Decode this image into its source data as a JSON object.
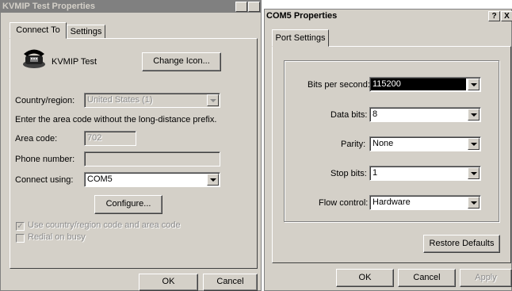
{
  "left_window": {
    "title": "KVMIP Test Properties",
    "help_button": "?",
    "close_button": "X",
    "tabs": [
      {
        "label": "Connect To"
      },
      {
        "label": "Settings"
      }
    ],
    "connection_name": "KVMIP Test",
    "change_icon_label": "Change Icon...",
    "country_label": "Country/region:",
    "country_value": "United States (1)",
    "area_instruction": "Enter the area code without the long-distance prefix.",
    "area_code_label": "Area code:",
    "area_code_value": "702",
    "phone_label": "Phone number:",
    "phone_value": "",
    "connect_using_label": "Connect using:",
    "connect_using_value": "COM5",
    "configure_label": "Configure...",
    "use_country_label": "Use country/region code and area code",
    "redial_label": "Redial on busy",
    "ok_label": "OK",
    "cancel_label": "Cancel"
  },
  "right_window": {
    "title": "COM5 Properties",
    "help_button": "?",
    "close_button": "X",
    "tab_label": "Port Settings",
    "bits_per_second_label": "Bits per second:",
    "bits_per_second_value": "115200",
    "data_bits_label": "Data bits:",
    "data_bits_value": "8",
    "parity_label": "Parity:",
    "parity_value": "None",
    "stop_bits_label": "Stop bits:",
    "stop_bits_value": "1",
    "flow_control_label": "Flow control:",
    "flow_control_value": "Hardware",
    "restore_defaults_label": "Restore Defaults",
    "ok_label": "OK",
    "cancel_label": "Cancel",
    "apply_label": "Apply"
  },
  "colors": {
    "dialog_face": "#d4d0c8",
    "inactive_title": "#808080",
    "active_title_text": "#000000",
    "selection": "#000000"
  },
  "icons": {
    "connection_icon": "telephone-icon"
  }
}
